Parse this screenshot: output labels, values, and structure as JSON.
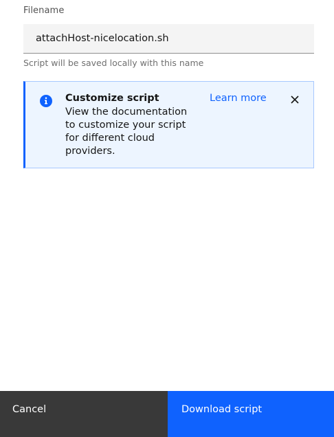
{
  "form": {
    "filename_label": "Filename",
    "filename_value": "attachHost-nicelocation.sh",
    "helper_text": "Script will be saved locally with this name"
  },
  "notification": {
    "kind": "info",
    "icon": "info-icon",
    "title": "Customize script",
    "body": "View the documentation to customize your script for different cloud providers.",
    "link_label": "Learn more",
    "close_icon": "close-icon"
  },
  "footer": {
    "cancel_label": "Cancel",
    "primary_label": "Download script"
  },
  "colors": {
    "accent": "#0f62fe",
    "notification_bg": "#edf5ff",
    "secondary_button": "#393939"
  }
}
